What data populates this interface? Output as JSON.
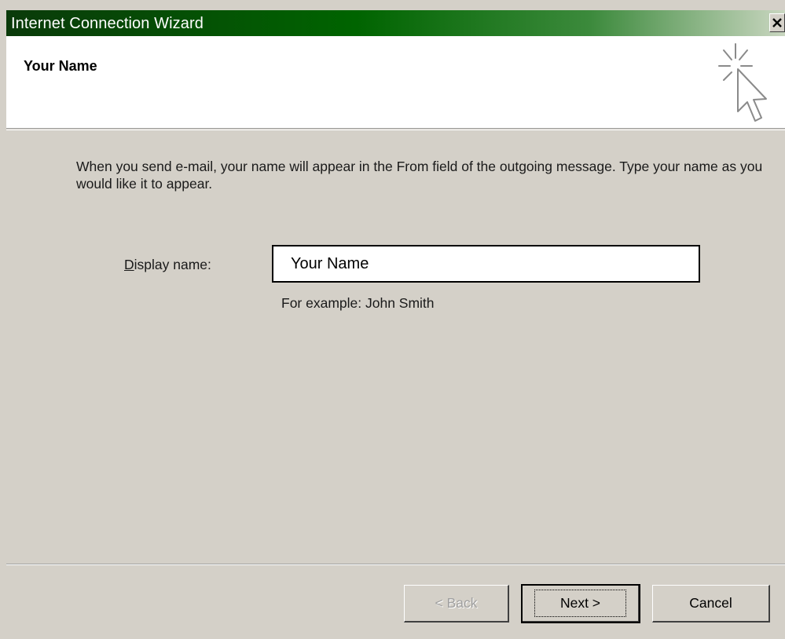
{
  "window": {
    "title": "Internet Connection Wizard"
  },
  "header": {
    "title": "Your Name",
    "icon": "wizard-cursor-icon"
  },
  "content": {
    "description": "When you send e-mail, your name will appear in the From field of the outgoing message. Type your name as you would like it to appear.",
    "display_name_label_accesskey": "D",
    "display_name_label_rest": "isplay name:",
    "display_name_value": "Your Name",
    "example_text": "For example: John Smith"
  },
  "buttons": {
    "back": "< Back",
    "next": "Next >",
    "cancel": "Cancel"
  },
  "colors": {
    "dialog_bg": "#d4d0c8",
    "titlebar_start": "#0a3a0a",
    "titlebar_end": "#c9d6c0"
  }
}
